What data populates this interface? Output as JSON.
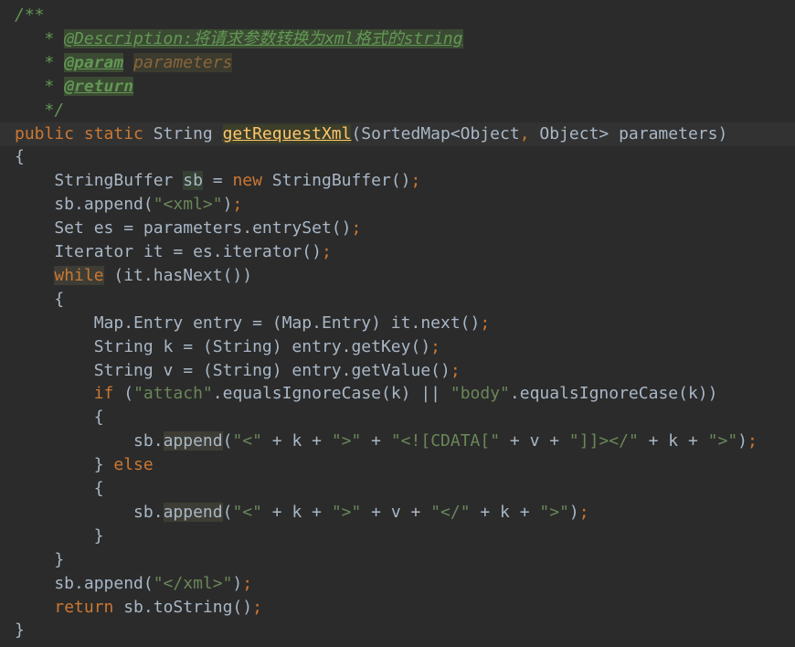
{
  "editor": {
    "lines": [
      [
        {
          "t": "/**",
          "c": "doc"
        }
      ],
      [
        {
          "t": "   * ",
          "c": "doc"
        },
        {
          "t": "@Description:将请求参数转换为xml格式的string",
          "c": "docdesc"
        }
      ],
      [
        {
          "t": "   * ",
          "c": "doc"
        },
        {
          "t": "@param",
          "c": "doctag"
        },
        {
          "t": " ",
          "c": "doc"
        },
        {
          "t": "parameters",
          "c": "docparam"
        }
      ],
      [
        {
          "t": "   * ",
          "c": "doc"
        },
        {
          "t": "@return",
          "c": "doctag"
        }
      ],
      [
        {
          "t": "   */",
          "c": "doc"
        }
      ],
      [
        {
          "t": "public static ",
          "c": "kw"
        },
        {
          "t": "String ",
          "c": "ident"
        },
        {
          "t": "",
          "c": "caret"
        },
        {
          "t": "getRequestXml",
          "c": "hl-decl"
        },
        {
          "t": "(SortedMap<Object",
          "c": "ident"
        },
        {
          "t": ", ",
          "c": "punc"
        },
        {
          "t": "Object> parameters)",
          "c": "ident"
        }
      ],
      [
        {
          "t": "{",
          "c": "ident"
        }
      ],
      [
        {
          "t": "    StringBuffer ",
          "c": "ident"
        },
        {
          "t": "sb",
          "c": "hl-var"
        },
        {
          "t": " = ",
          "c": "op"
        },
        {
          "t": "new ",
          "c": "kw"
        },
        {
          "t": "StringBuffer()",
          "c": "ident"
        },
        {
          "t": ";",
          "c": "punc"
        }
      ],
      [
        {
          "t": "    sb.append(",
          "c": "ident"
        },
        {
          "t": "\"<xml>\"",
          "c": "str"
        },
        {
          "t": ")",
          "c": "ident"
        },
        {
          "t": ";",
          "c": "punc"
        }
      ],
      [
        {
          "t": "    Set es = parameters.entrySet()",
          "c": "ident"
        },
        {
          "t": ";",
          "c": "punc"
        }
      ],
      [
        {
          "t": "    Iterator it = es.iterator()",
          "c": "ident"
        },
        {
          "t": ";",
          "c": "punc"
        }
      ],
      [
        {
          "t": "    ",
          "c": "ident"
        },
        {
          "t": "while",
          "c": "kw hl-kw"
        },
        {
          "t": " (it.hasNext())",
          "c": "ident"
        }
      ],
      [
        {
          "t": "    {",
          "c": "ident"
        }
      ],
      [
        {
          "t": "        Map.Entry entry = (Map.Entry) it.next()",
          "c": "ident"
        },
        {
          "t": ";",
          "c": "punc"
        }
      ],
      [
        {
          "t": "        String k = (String) entry.getKey()",
          "c": "ident"
        },
        {
          "t": ";",
          "c": "punc"
        }
      ],
      [
        {
          "t": "        String v = (String) entry.getValue()",
          "c": "ident"
        },
        {
          "t": ";",
          "c": "punc"
        }
      ],
      [
        {
          "t": "        ",
          "c": "ident"
        },
        {
          "t": "if ",
          "c": "kw"
        },
        {
          "t": "(",
          "c": "ident"
        },
        {
          "t": "\"attach\"",
          "c": "str"
        },
        {
          "t": ".equalsIgnoreCase(k) || ",
          "c": "ident"
        },
        {
          "t": "\"body\"",
          "c": "str"
        },
        {
          "t": ".equalsIgnoreCase(k))",
          "c": "ident"
        }
      ],
      [
        {
          "t": "        {",
          "c": "ident"
        }
      ],
      [
        {
          "t": "            sb.",
          "c": "ident"
        },
        {
          "t": "append",
          "c": "ident hl-method"
        },
        {
          "t": "(",
          "c": "ident"
        },
        {
          "t": "\"<\"",
          "c": "str"
        },
        {
          "t": " + k + ",
          "c": "ident"
        },
        {
          "t": "\">\"",
          "c": "str"
        },
        {
          "t": " + ",
          "c": "ident"
        },
        {
          "t": "\"<![CDATA[\"",
          "c": "str"
        },
        {
          "t": " + v + ",
          "c": "ident"
        },
        {
          "t": "\"]]></\"",
          "c": "str"
        },
        {
          "t": " + k + ",
          "c": "ident"
        },
        {
          "t": "\">\"",
          "c": "str"
        },
        {
          "t": ")",
          "c": "ident"
        },
        {
          "t": ";",
          "c": "punc"
        }
      ],
      [
        {
          "t": "        } ",
          "c": "ident"
        },
        {
          "t": "else",
          "c": "kw"
        }
      ],
      [
        {
          "t": "        {",
          "c": "ident"
        }
      ],
      [
        {
          "t": "            sb.",
          "c": "ident"
        },
        {
          "t": "append",
          "c": "ident hl-method"
        },
        {
          "t": "(",
          "c": "ident"
        },
        {
          "t": "\"<\"",
          "c": "str"
        },
        {
          "t": " + k + ",
          "c": "ident"
        },
        {
          "t": "\">\"",
          "c": "str"
        },
        {
          "t": " + v + ",
          "c": "ident"
        },
        {
          "t": "\"</\"",
          "c": "str"
        },
        {
          "t": " + k + ",
          "c": "ident"
        },
        {
          "t": "\">\"",
          "c": "str"
        },
        {
          "t": ")",
          "c": "ident"
        },
        {
          "t": ";",
          "c": "punc"
        }
      ],
      [
        {
          "t": "        }",
          "c": "ident"
        }
      ],
      [
        {
          "t": "    }",
          "c": "ident"
        }
      ],
      [
        {
          "t": "    sb.append(",
          "c": "ident"
        },
        {
          "t": "\"</xml>\"",
          "c": "str"
        },
        {
          "t": ")",
          "c": "ident"
        },
        {
          "t": ";",
          "c": "punc"
        }
      ],
      [
        {
          "t": "    ",
          "c": "ident"
        },
        {
          "t": "return ",
          "c": "kw"
        },
        {
          "t": "sb.toString()",
          "c": "ident"
        },
        {
          "t": ";",
          "c": "punc"
        }
      ],
      [
        {
          "t": "}",
          "c": "ident"
        }
      ]
    ]
  }
}
